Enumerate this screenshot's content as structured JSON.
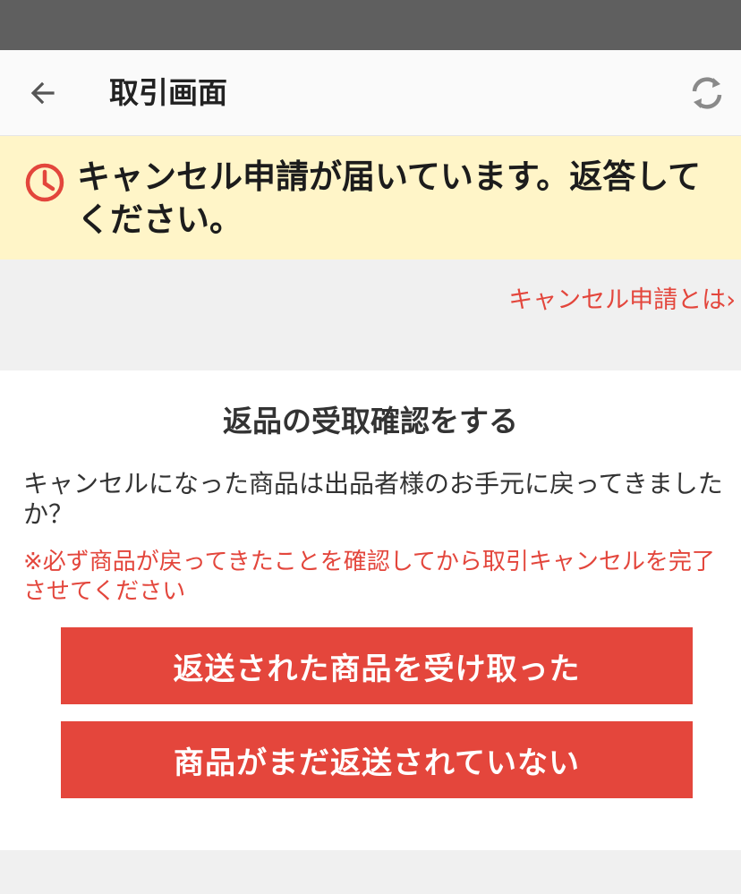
{
  "appbar": {
    "title": "取引画面",
    "back_icon": "arrow-left-icon",
    "refresh_icon": "refresh-icon"
  },
  "notice": {
    "icon": "clock-icon",
    "text": "キャンセル申請が届いています。返答してください。",
    "icon_color": "#e3463c",
    "background": "#fff5c8"
  },
  "help_link": {
    "label": "キャンセル申請とは",
    "chevron": "›"
  },
  "card": {
    "title": "返品の受取確認をする",
    "question": "キャンセルになった商品は出品者様のお手元に戻ってきましたか？",
    "warning": "※必ず商品が戻ってきたことを確認してから取引キャンセルを完了させてください"
  },
  "buttons": {
    "received_label": "返送された商品を受け取った",
    "not_returned_label": "商品がまだ返送されていない",
    "color": "#e4463c"
  }
}
